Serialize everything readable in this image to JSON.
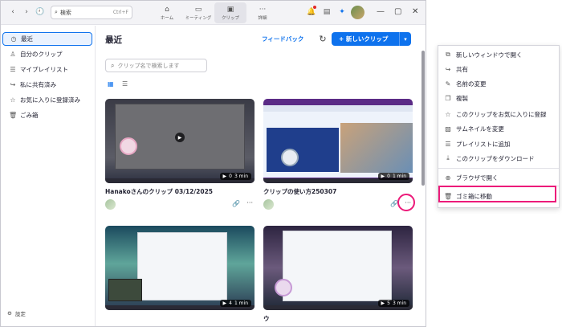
{
  "titlebar": {
    "search_label": "検索",
    "search_shortcut": "Ctrl+F",
    "tabs": [
      {
        "label": "ホーム",
        "icon": "home-icon"
      },
      {
        "label": "ミーティング",
        "icon": "video-icon"
      },
      {
        "label": "クリップ",
        "icon": "clip-icon"
      },
      {
        "label": "詳細",
        "icon": "more-icon"
      }
    ],
    "active_tab": "クリップ"
  },
  "sidebar": {
    "items": [
      {
        "label": "最近",
        "icon": "clock-icon",
        "active": true
      },
      {
        "label": "自分のクリップ",
        "icon": "person-icon"
      },
      {
        "label": "マイプレイリスト",
        "icon": "playlist-icon"
      },
      {
        "label": "私に共有済み",
        "icon": "share-icon"
      },
      {
        "label": "お気に入りに登録済み",
        "icon": "star-icon"
      },
      {
        "label": "ごみ箱",
        "icon": "trash-icon"
      }
    ],
    "settings_label": "設定"
  },
  "main": {
    "title": "最近",
    "feedback_label": "フィードバック",
    "new_clip_label": "+ 新しいクリップ",
    "search_placeholder": "クリップ名で検索します",
    "cards": [
      {
        "title": "Hanakoさんのクリップ 03/12/2025",
        "views": "0",
        "duration": "3 min"
      },
      {
        "title": "クリップの使い方250307",
        "views": "0",
        "duration": "1 min"
      },
      {
        "title": "",
        "views": "4",
        "duration": "1 min"
      },
      {
        "title": "ウ",
        "views": "5",
        "duration": "3 min"
      }
    ]
  },
  "context_menu": {
    "items": [
      {
        "label": "新しいウィンドウで開く",
        "icon": "external-window-icon"
      },
      {
        "label": "共有",
        "icon": "share-icon"
      },
      {
        "label": "名前の変更",
        "icon": "pencil-icon"
      },
      {
        "label": "複製",
        "icon": "duplicate-icon"
      },
      {
        "label": "このクリップをお気に入りに登録",
        "icon": "star-icon"
      },
      {
        "label": "サムネイルを変更",
        "icon": "image-icon"
      },
      {
        "label": "プレイリストに追加",
        "icon": "playlist-icon"
      },
      {
        "label": "このクリップをダウンロード",
        "icon": "download-icon"
      },
      {
        "label": "ブラウザで開く",
        "icon": "globe-icon"
      },
      {
        "label": "ゴミ箱に移動",
        "icon": "trash-icon"
      }
    ],
    "highlighted": "ゴミ箱に移動"
  },
  "colors": {
    "accent": "#0e72ed",
    "highlight": "#ec1b7a"
  }
}
